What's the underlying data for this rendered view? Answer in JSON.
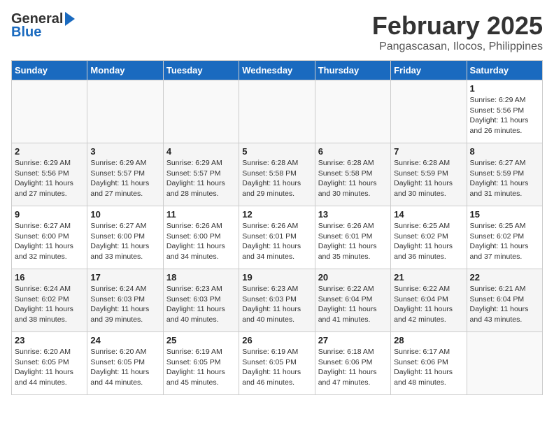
{
  "header": {
    "logo_general": "General",
    "logo_blue": "Blue",
    "title": "February 2025",
    "subtitle": "Pangascasan, Ilocos, Philippines"
  },
  "days_of_week": [
    "Sunday",
    "Monday",
    "Tuesday",
    "Wednesday",
    "Thursday",
    "Friday",
    "Saturday"
  ],
  "weeks": [
    [
      {
        "num": "",
        "info": ""
      },
      {
        "num": "",
        "info": ""
      },
      {
        "num": "",
        "info": ""
      },
      {
        "num": "",
        "info": ""
      },
      {
        "num": "",
        "info": ""
      },
      {
        "num": "",
        "info": ""
      },
      {
        "num": "1",
        "info": "Sunrise: 6:29 AM\nSunset: 5:56 PM\nDaylight: 11 hours and 26 minutes."
      }
    ],
    [
      {
        "num": "2",
        "info": "Sunrise: 6:29 AM\nSunset: 5:56 PM\nDaylight: 11 hours and 27 minutes."
      },
      {
        "num": "3",
        "info": "Sunrise: 6:29 AM\nSunset: 5:57 PM\nDaylight: 11 hours and 27 minutes."
      },
      {
        "num": "4",
        "info": "Sunrise: 6:29 AM\nSunset: 5:57 PM\nDaylight: 11 hours and 28 minutes."
      },
      {
        "num": "5",
        "info": "Sunrise: 6:28 AM\nSunset: 5:58 PM\nDaylight: 11 hours and 29 minutes."
      },
      {
        "num": "6",
        "info": "Sunrise: 6:28 AM\nSunset: 5:58 PM\nDaylight: 11 hours and 30 minutes."
      },
      {
        "num": "7",
        "info": "Sunrise: 6:28 AM\nSunset: 5:59 PM\nDaylight: 11 hours and 30 minutes."
      },
      {
        "num": "8",
        "info": "Sunrise: 6:27 AM\nSunset: 5:59 PM\nDaylight: 11 hours and 31 minutes."
      }
    ],
    [
      {
        "num": "9",
        "info": "Sunrise: 6:27 AM\nSunset: 6:00 PM\nDaylight: 11 hours and 32 minutes."
      },
      {
        "num": "10",
        "info": "Sunrise: 6:27 AM\nSunset: 6:00 PM\nDaylight: 11 hours and 33 minutes."
      },
      {
        "num": "11",
        "info": "Sunrise: 6:26 AM\nSunset: 6:00 PM\nDaylight: 11 hours and 34 minutes."
      },
      {
        "num": "12",
        "info": "Sunrise: 6:26 AM\nSunset: 6:01 PM\nDaylight: 11 hours and 34 minutes."
      },
      {
        "num": "13",
        "info": "Sunrise: 6:26 AM\nSunset: 6:01 PM\nDaylight: 11 hours and 35 minutes."
      },
      {
        "num": "14",
        "info": "Sunrise: 6:25 AM\nSunset: 6:02 PM\nDaylight: 11 hours and 36 minutes."
      },
      {
        "num": "15",
        "info": "Sunrise: 6:25 AM\nSunset: 6:02 PM\nDaylight: 11 hours and 37 minutes."
      }
    ],
    [
      {
        "num": "16",
        "info": "Sunrise: 6:24 AM\nSunset: 6:02 PM\nDaylight: 11 hours and 38 minutes."
      },
      {
        "num": "17",
        "info": "Sunrise: 6:24 AM\nSunset: 6:03 PM\nDaylight: 11 hours and 39 minutes."
      },
      {
        "num": "18",
        "info": "Sunrise: 6:23 AM\nSunset: 6:03 PM\nDaylight: 11 hours and 40 minutes."
      },
      {
        "num": "19",
        "info": "Sunrise: 6:23 AM\nSunset: 6:03 PM\nDaylight: 11 hours and 40 minutes."
      },
      {
        "num": "20",
        "info": "Sunrise: 6:22 AM\nSunset: 6:04 PM\nDaylight: 11 hours and 41 minutes."
      },
      {
        "num": "21",
        "info": "Sunrise: 6:22 AM\nSunset: 6:04 PM\nDaylight: 11 hours and 42 minutes."
      },
      {
        "num": "22",
        "info": "Sunrise: 6:21 AM\nSunset: 6:04 PM\nDaylight: 11 hours and 43 minutes."
      }
    ],
    [
      {
        "num": "23",
        "info": "Sunrise: 6:20 AM\nSunset: 6:05 PM\nDaylight: 11 hours and 44 minutes."
      },
      {
        "num": "24",
        "info": "Sunrise: 6:20 AM\nSunset: 6:05 PM\nDaylight: 11 hours and 44 minutes."
      },
      {
        "num": "25",
        "info": "Sunrise: 6:19 AM\nSunset: 6:05 PM\nDaylight: 11 hours and 45 minutes."
      },
      {
        "num": "26",
        "info": "Sunrise: 6:19 AM\nSunset: 6:05 PM\nDaylight: 11 hours and 46 minutes."
      },
      {
        "num": "27",
        "info": "Sunrise: 6:18 AM\nSunset: 6:06 PM\nDaylight: 11 hours and 47 minutes."
      },
      {
        "num": "28",
        "info": "Sunrise: 6:17 AM\nSunset: 6:06 PM\nDaylight: 11 hours and 48 minutes."
      },
      {
        "num": "",
        "info": ""
      }
    ]
  ]
}
